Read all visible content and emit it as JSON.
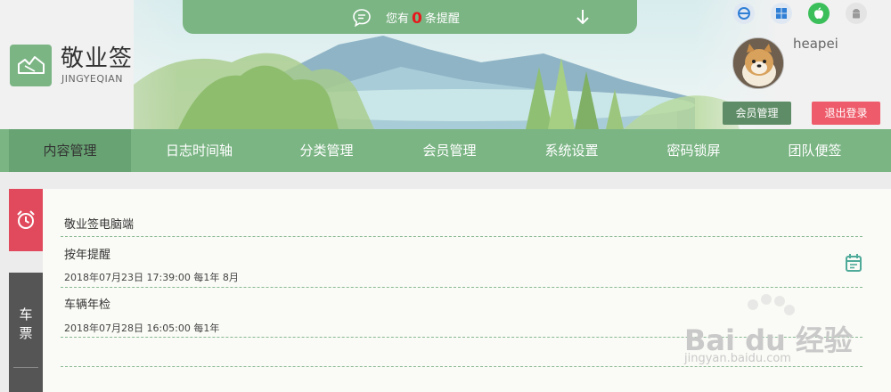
{
  "notice": {
    "prefix": "您有",
    "count": "0",
    "suffix": "条提醒"
  },
  "brand": {
    "name": "敬业签",
    "pinyin": "JINGYEQIAN"
  },
  "platforms": [
    "ie-icon",
    "windows-icon",
    "apple-icon",
    "android-icon"
  ],
  "user": {
    "name": "heapei",
    "member_button": "会员管理",
    "logout_button": "退出登录"
  },
  "nav": {
    "items": [
      "内容管理",
      "日志时间轴",
      "分类管理",
      "会员管理",
      "系统设置",
      "密码锁屏",
      "团队便签"
    ],
    "active_index": 0
  },
  "tabs": {
    "car_line1": "车",
    "car_line2": "票"
  },
  "content": {
    "section_title": "敬业签电脑端",
    "items": [
      {
        "title": "按年提醒",
        "meta": "2018年07月23日 17:39:00 每1年 8月"
      },
      {
        "title": "车辆年检",
        "meta": "2018年07月28日 16:05:00 每1年"
      }
    ]
  },
  "watermark": {
    "brand": "Bai du 经验",
    "url": "jingyan.baidu.com"
  },
  "colors": {
    "primary_green": "#7bb584",
    "dark_green": "#5e8c66",
    "alert_red": "#e14a5d",
    "logout_pink": "#ee5b6a",
    "tab_gray": "#555555"
  }
}
